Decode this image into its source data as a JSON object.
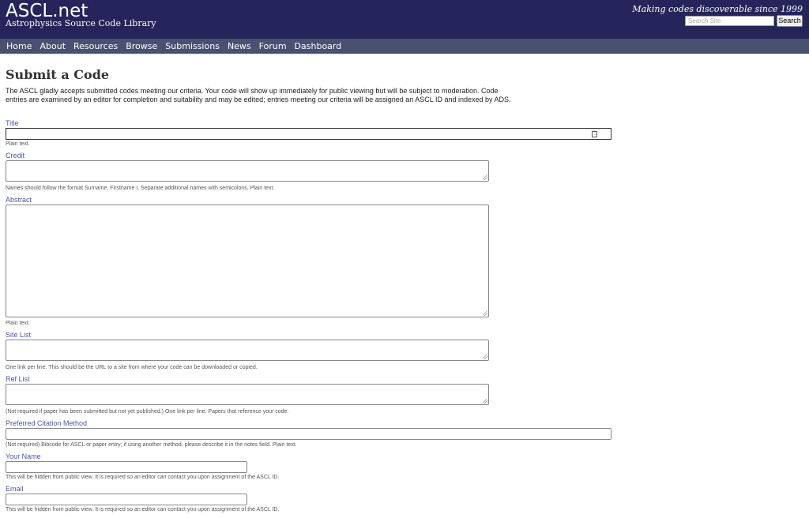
{
  "header": {
    "title": "ASCL.net",
    "subtitle": "Astrophysics Source Code Library",
    "tagline": "Making codes discoverable since 1999",
    "search_placeholder": "Search Site",
    "search_button": "Search"
  },
  "nav": {
    "items": [
      {
        "label": "Home"
      },
      {
        "label": "About"
      },
      {
        "label": "Resources"
      },
      {
        "label": "Browse"
      },
      {
        "label": "Submissions"
      },
      {
        "label": "News"
      },
      {
        "label": "Forum"
      },
      {
        "label": "Dashboard"
      }
    ]
  },
  "page": {
    "title": "Submit a Code",
    "intro": "The ASCL gladly accepts submitted codes meeting our criteria. Your code will show up immediately for public viewing but will be subject to moderation. Code entries are examined by an editor for completion and suitability and may be edited; entries meeting our criteria will be assigned an ASCL ID and indexed by ADS."
  },
  "form": {
    "title": {
      "label": "Title",
      "help": "Plain text.",
      "value": ""
    },
    "credit": {
      "label": "Credit",
      "help": "Names should follow the format Surname, Firstname I. Separate additional names with semicolons. Plain text.",
      "value": ""
    },
    "abstract": {
      "label": "Abstract",
      "help": "Plain text.",
      "value": ""
    },
    "site_list": {
      "label": "Site List",
      "help": "One link per line. This should be the URL to a site from where your code can be downloaded or copied.",
      "value": ""
    },
    "ref_list": {
      "label": "Ref List",
      "help": "(Not required if paper has been submitted but not yet published.) One link per line. Papers that reference your code.",
      "value": ""
    },
    "citation": {
      "label": "Preferred Citation Method",
      "help": "(Not required) Bibcode for ASCL or paper entry; if using another method, please describe it in the notes field. Plain text.",
      "value": ""
    },
    "your_name": {
      "label": "Your Name",
      "help": "This will be hidden from public view. It is required so an editor can contact you upon assignment of the ASCL ID.",
      "value": ""
    },
    "email": {
      "label": "Email",
      "help": "This will be hidden from public view. It is required so an editor can contact you upon assignment of the ASCL ID.",
      "value": ""
    }
  },
  "colors": {
    "header_bg": "#25255c",
    "nav_bg": "#4a5070",
    "label": "#4d56b0"
  }
}
